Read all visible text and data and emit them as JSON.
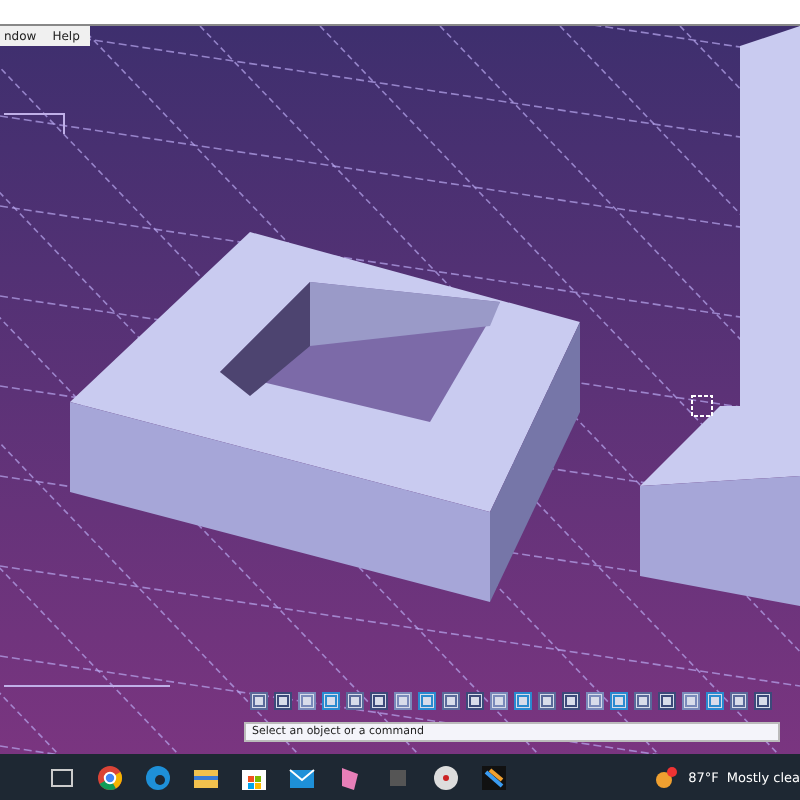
{
  "menu": [
    {
      "label": "ndow"
    },
    {
      "label": "Help"
    }
  ],
  "command_line": {
    "prompt": "Select an object or a command"
  },
  "taskbar": {
    "weather": {
      "temperature": "87°F",
      "condition": "Mostly clea"
    }
  }
}
